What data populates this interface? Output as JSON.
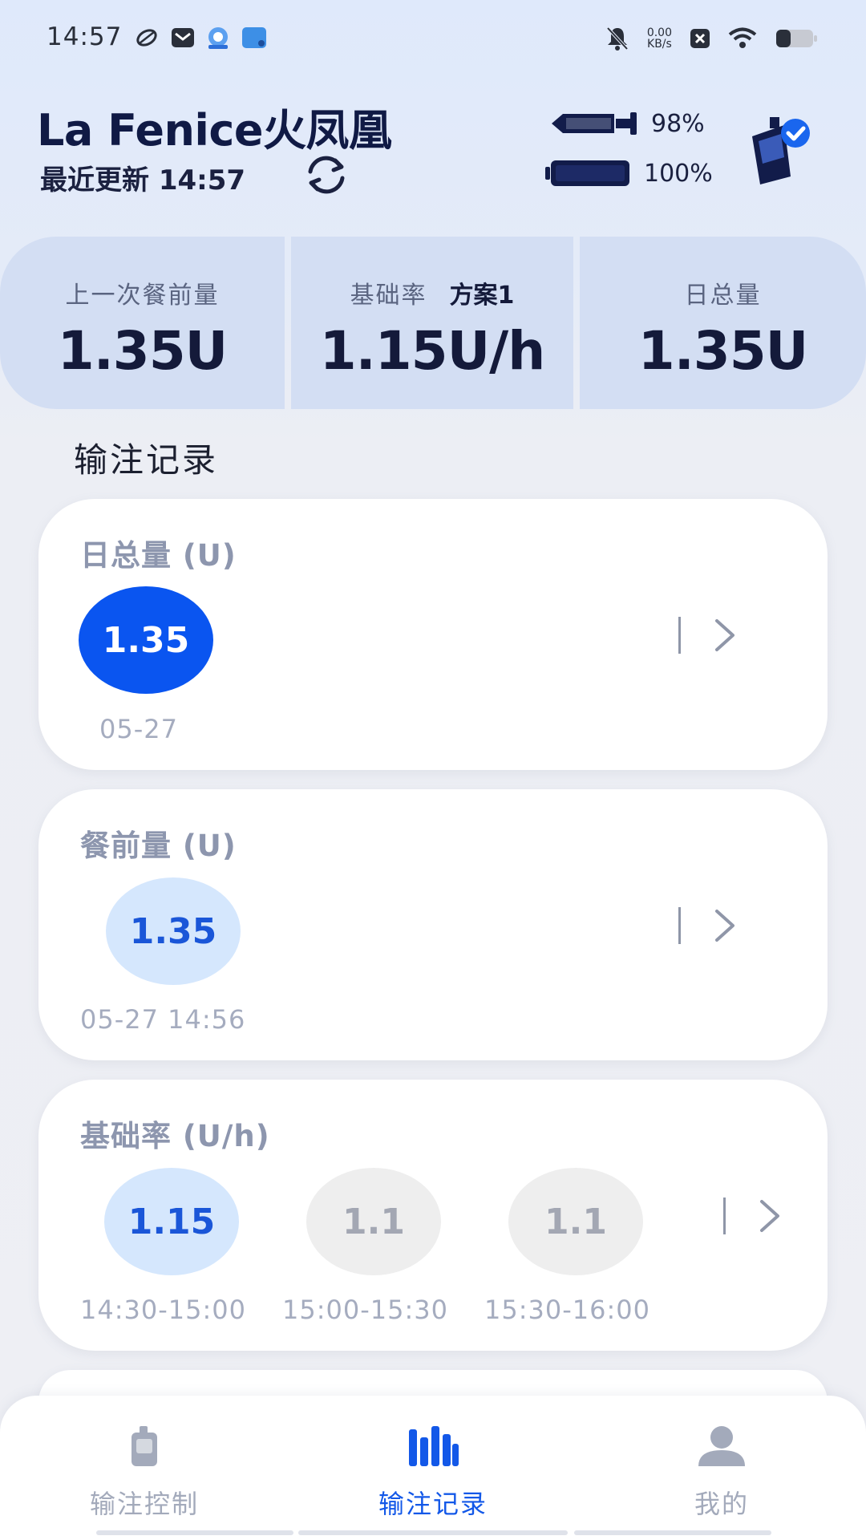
{
  "status_bar": {
    "time": "14:57",
    "net_speed_value": "0.00",
    "net_speed_unit": "KB/s"
  },
  "header": {
    "app_title": "La Fenice火凤凰",
    "last_update": "最近更新 14:57",
    "reservoir_percent": "98%",
    "battery_percent": "100%"
  },
  "summary": {
    "last_bolus_label": "上一次餐前量",
    "last_bolus_value": "1.35U",
    "basal_label": "基础率",
    "basal_plan": "方案1",
    "basal_value": "1.15U/h",
    "daily_total_label": "日总量",
    "daily_total_value": "1.35U"
  },
  "section_title": "输注记录",
  "cards": {
    "daily_total": {
      "title": "日总量 (U)",
      "items": [
        {
          "value": "1.35",
          "date": "05-27"
        }
      ]
    },
    "bolus": {
      "title": "餐前量 (U)",
      "items": [
        {
          "value": "1.35",
          "date": "05-27 14:56"
        }
      ]
    },
    "basal": {
      "title": "基础率 (U/h)",
      "items": [
        {
          "value": "1.15",
          "time": "14:30-15:00"
        },
        {
          "value": "1.1",
          "time": "15:00-15:30"
        },
        {
          "value": "1.1",
          "time": "15:30-16:00"
        }
      ]
    }
  },
  "bottom_nav": {
    "items": [
      {
        "label": "输注控制",
        "icon": "pump-device-icon"
      },
      {
        "label": "输注记录",
        "icon": "bar-chart-icon",
        "active": true
      },
      {
        "label": "我的",
        "icon": "person-icon"
      }
    ]
  },
  "colors": {
    "accent": "#0a55f0",
    "chip_light": "#d5e7fd",
    "chip_grey": "#eeeeee",
    "summary_bg": "#d3def3"
  }
}
